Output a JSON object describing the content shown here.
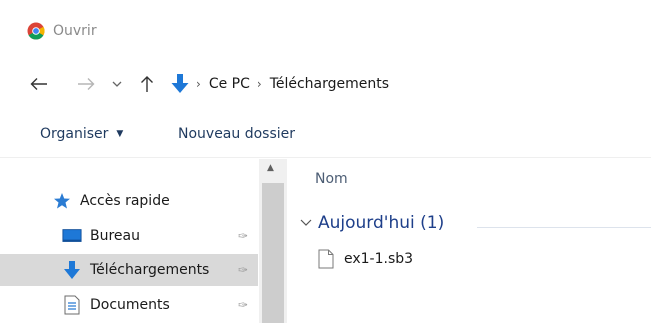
{
  "window": {
    "title": "Ouvrir"
  },
  "breadcrumb": {
    "items": [
      "Ce PC",
      "Téléchargements"
    ]
  },
  "toolbar": {
    "organiser_label": "Organiser",
    "new_folder_label": "Nouveau dossier"
  },
  "sidebar": {
    "quick_access": "Accès rapide",
    "items": [
      {
        "label": "Bureau",
        "icon": "desktop-icon",
        "pinned": true
      },
      {
        "label": "Téléchargements",
        "icon": "download-arrow-icon",
        "pinned": true,
        "selected": true
      },
      {
        "label": "Documents",
        "icon": "document-icon",
        "pinned": true
      }
    ]
  },
  "content": {
    "column_name": "Nom",
    "group_label": "Aujourd'hui (1)",
    "files": [
      {
        "name": "ex1-1.sb3",
        "icon": "file-icon"
      }
    ]
  },
  "colors": {
    "accent": "#1e78d7",
    "selected_row": "#d9d9d9",
    "group_text": "#1e3f8a"
  }
}
